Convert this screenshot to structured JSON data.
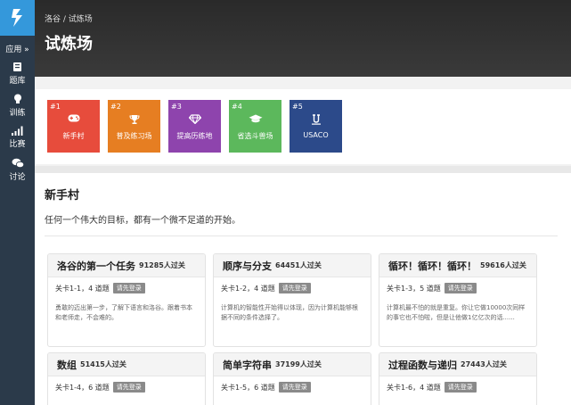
{
  "sidebar": {
    "apps_label": "应用 »",
    "items": [
      {
        "label": "题库",
        "icon": "book-icon"
      },
      {
        "label": "训练",
        "icon": "lightbulb-icon"
      },
      {
        "label": "比赛",
        "icon": "signal-bars-icon"
      },
      {
        "label": "讨论",
        "icon": "chat-bubbles-icon"
      }
    ]
  },
  "header": {
    "breadcrumb": "洛谷 / 试炼场",
    "title": "试炼场"
  },
  "levels": [
    {
      "num": "#1",
      "label": "新手村",
      "icon": "gamepad-icon",
      "color": "#e74c3c"
    },
    {
      "num": "#2",
      "label": "普及练习场",
      "icon": "trophy-icon",
      "color": "#e67e22"
    },
    {
      "num": "#3",
      "label": "提高历练地",
      "icon": "diamond-icon",
      "color": "#8e44ad"
    },
    {
      "num": "#4",
      "label": "省选斗兽场",
      "icon": "graduation-cap-icon",
      "color": "#5cb85c"
    },
    {
      "num": "#5",
      "label": "USACO",
      "icon": "usaco-u-icon",
      "color": "#2c4a8a"
    }
  ],
  "section": {
    "title": "新手村",
    "desc": "任何一个伟大的目标，都有一个微不足道的开始。"
  },
  "login_label": "请先登录",
  "cards": [
    {
      "title": "洛谷的第一个任务",
      "count": "91285人过关",
      "meta": "关卡1-1，4 道题",
      "desc": "勇敢的迈出第一步，了解下语言和洛谷。跟着书本和老师走，不会难的。"
    },
    {
      "title": "顺序与分支",
      "count": "64451人过关",
      "meta": "关卡1-2，4 道题",
      "desc": "计算机的智能性开始得以体现，因为计算机能够根据不同的条件选择了。"
    },
    {
      "title": "循环！循环！循环！",
      "count": "59616人过关",
      "meta": "关卡1-3，5 道题",
      "desc": "计算机最不怕的就是重复。你让它做10000次同样的事它也不怕啦，但是让他做1亿亿次的话......"
    },
    {
      "title": "数组",
      "count": "51415人过关",
      "meta": "关卡1-4，6 道题",
      "desc": ""
    },
    {
      "title": "简单字符串",
      "count": "37199人过关",
      "meta": "关卡1-5，6 道题",
      "desc": ""
    },
    {
      "title": "过程函数与递归",
      "count": "27443人过关",
      "meta": "关卡1-6，4 道题",
      "desc": ""
    }
  ]
}
